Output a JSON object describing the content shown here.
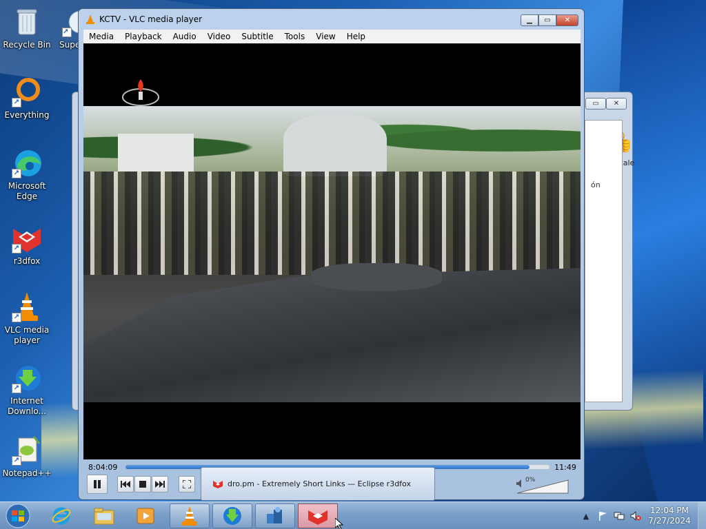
{
  "desktop": {
    "icons": [
      {
        "label": "Recycle Bin",
        "icon": "recycle-bin-icon"
      },
      {
        "label": "Everything",
        "icon": "everything-search-icon"
      },
      {
        "label": "Microsoft Edge",
        "icon": "edge-icon"
      },
      {
        "label": "r3dfox",
        "icon": "r3dfox-icon"
      },
      {
        "label": "VLC media player",
        "icon": "vlc-cone-icon"
      },
      {
        "label": "Internet Downlo...",
        "icon": "idm-icon"
      },
      {
        "label": "Notepad++",
        "icon": "notepadpp-icon"
      }
    ],
    "partial_icon_label": "Supe"
  },
  "background_window": {
    "partial_label": "Cuéntale",
    "partial_column": "ón"
  },
  "vlc": {
    "title": "KCTV - VLC media player",
    "menu": [
      "Media",
      "Playback",
      "Audio",
      "Video",
      "Subtitle",
      "Tools",
      "View",
      "Help"
    ],
    "elapsed": "8:04:09",
    "remaining": "11:49",
    "progress": 0.953,
    "volume_text": "0%",
    "buttons": [
      "pause",
      "previous",
      "stop",
      "next",
      "fullscreen"
    ]
  },
  "taskbar_preview": {
    "text": "dro.pm - Extremely Short Links — Eclipse r3dfox"
  },
  "taskbar": {
    "pinned": [
      "internet-explorer",
      "file-explorer",
      "media-player",
      "vlc",
      "internet-download-manager",
      "connection-manager",
      "r3dfox"
    ]
  },
  "tray": {
    "time": "12:04 PM",
    "date": "7/27/2024"
  },
  "colors": {
    "accent": "#2e74cc",
    "vlc_orange": "#f28c00",
    "r3dfox_red": "#e0332e"
  }
}
